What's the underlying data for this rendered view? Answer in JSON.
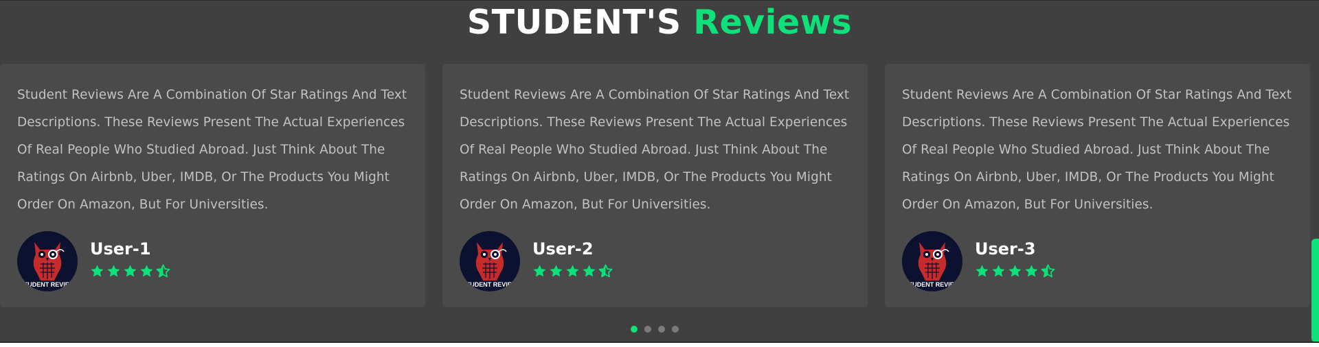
{
  "heading": {
    "part1": "STUDENT'S",
    "part2": "Reviews"
  },
  "reviews": [
    {
      "text": "Student Reviews Are A Combination Of Star Ratings And Text Descriptions. These Reviews Present The Actual Experiences Of Real People Who Studied Abroad. Just Think About The Ratings On Airbnb, Uber, IMDB, Or The Products You Might Order On Amazon, But For Universities.",
      "user": "User-1",
      "rating": 4.5,
      "avatar_caption": "STUDENT REVIEW"
    },
    {
      "text": "Student Reviews Are A Combination Of Star Ratings And Text Descriptions. These Reviews Present The Actual Experiences Of Real People Who Studied Abroad. Just Think About The Ratings On Airbnb, Uber, IMDB, Or The Products You Might Order On Amazon, But For Universities.",
      "user": "User-2",
      "rating": 4.5,
      "avatar_caption": "STUDENT REVIEW"
    },
    {
      "text": "Student Reviews Are A Combination Of Star Ratings And Text Descriptions. These Reviews Present The Actual Experiences Of Real People Who Studied Abroad. Just Think About The Ratings On Airbnb, Uber, IMDB, Or The Products You Might Order On Amazon, But For Universities.",
      "user": "User-3",
      "rating": 4.5,
      "avatar_caption": "STUDENT REVIEW"
    }
  ],
  "carousel": {
    "page_count": 4,
    "active_index": 0
  },
  "colors": {
    "accent": "#0ee17a",
    "background": "#404040",
    "card": "#4a4a4a",
    "text": "#c2c2c2"
  }
}
